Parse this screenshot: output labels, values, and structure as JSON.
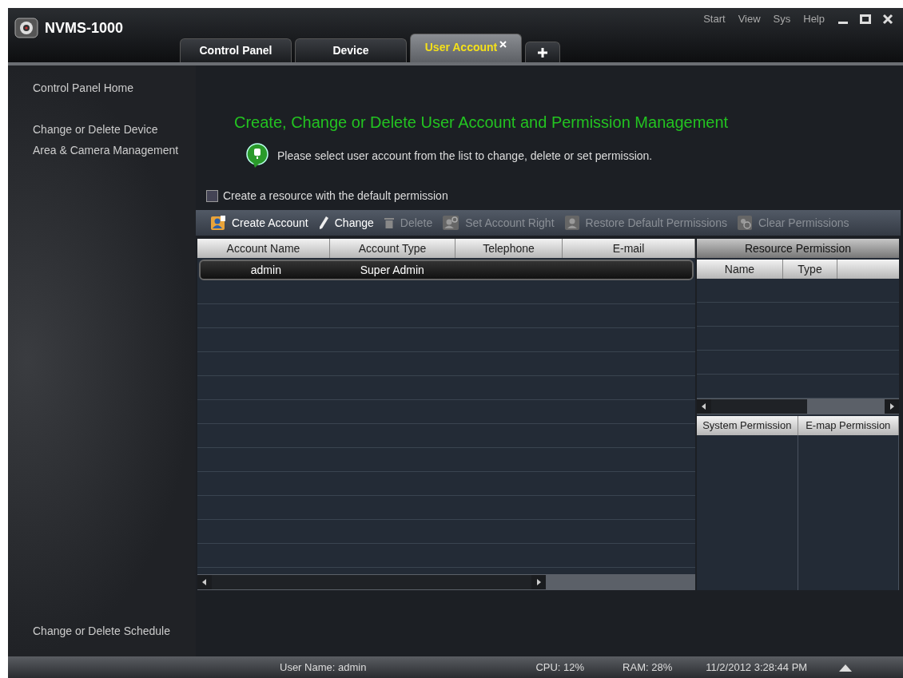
{
  "app": {
    "title": "NVMS-1000"
  },
  "menu": [
    "Start",
    "View",
    "Sys",
    "Help"
  ],
  "tabs": [
    {
      "label": "Control Panel",
      "selected": false,
      "closable": false
    },
    {
      "label": "Device",
      "selected": false,
      "closable": false
    },
    {
      "label": "User Account",
      "selected": true,
      "closable": true
    }
  ],
  "sidebar": {
    "top_items": [
      "Control Panel Home",
      "Change or Delete Device",
      "Area & Camera Management"
    ],
    "bottom_items": [
      "Change or Delete Schedule"
    ]
  },
  "heading": "Create, Change or Delete User Account and Permission Management",
  "tip": "Please select user account from the list to change, delete or set permission.",
  "default_permission": {
    "label": "Create a resource with the default permission",
    "checked": false
  },
  "toolbar": [
    {
      "kind": "create",
      "label": "Create Account",
      "disabled": false
    },
    {
      "kind": "change",
      "label": "Change",
      "disabled": false
    },
    {
      "kind": "delete",
      "label": "Delete",
      "disabled": true
    },
    {
      "kind": "right",
      "label": "Set Account Right",
      "disabled": true
    },
    {
      "kind": "restore",
      "label": "Restore Default Permissions",
      "disabled": true
    },
    {
      "kind": "clear",
      "label": "Clear Permissions",
      "disabled": true
    }
  ],
  "accounts": {
    "columns": [
      "Account Name",
      "Account Type",
      "Telephone",
      "E-mail"
    ],
    "rows": [
      {
        "cells": [
          "admin",
          "Super Admin",
          "",
          ""
        ],
        "selected": true
      }
    ]
  },
  "resource_permission": {
    "title": "Resource Permission",
    "columns": [
      "Name",
      "Type"
    ],
    "tabs": [
      "System Permission",
      "E-map Permission"
    ]
  },
  "status_bar": {
    "user": "User Name: admin",
    "cpu": "CPU: 12%",
    "ram": "RAM: 28%",
    "time": "11/2/2012 3:28:44 PM"
  }
}
